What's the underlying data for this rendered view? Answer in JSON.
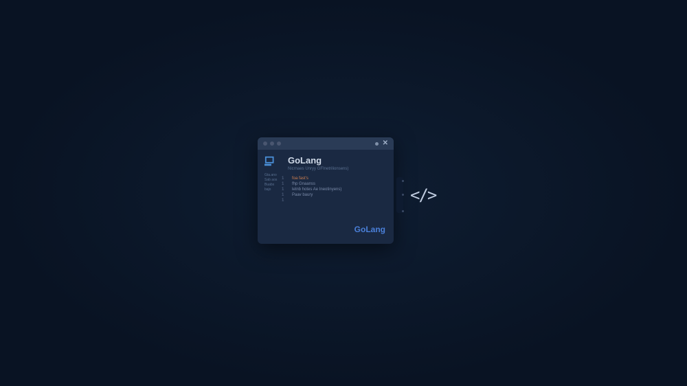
{
  "window": {
    "title": "GoLang",
    "subtitle": "Nicrnaes Unryy GFInetrilionsens)",
    "sidebar": {
      "items": [
        "Gta.ano",
        "Sab aos",
        "Buabs",
        "bajo"
      ]
    },
    "gutter": [
      "1",
      "1",
      "1",
      "1",
      "1"
    ],
    "code": [
      {
        "text": "foa fast's",
        "variant": "orange"
      },
      {
        "text": "fhp Gnaanss",
        "variant": "normal"
      },
      {
        "text": "letnb hotes Ae Ineotinyens)",
        "variant": "normal"
      },
      {
        "text": "Paav baury",
        "variant": "normal"
      }
    ],
    "footer_logo": "GoLang"
  },
  "code_tag": "</>"
}
